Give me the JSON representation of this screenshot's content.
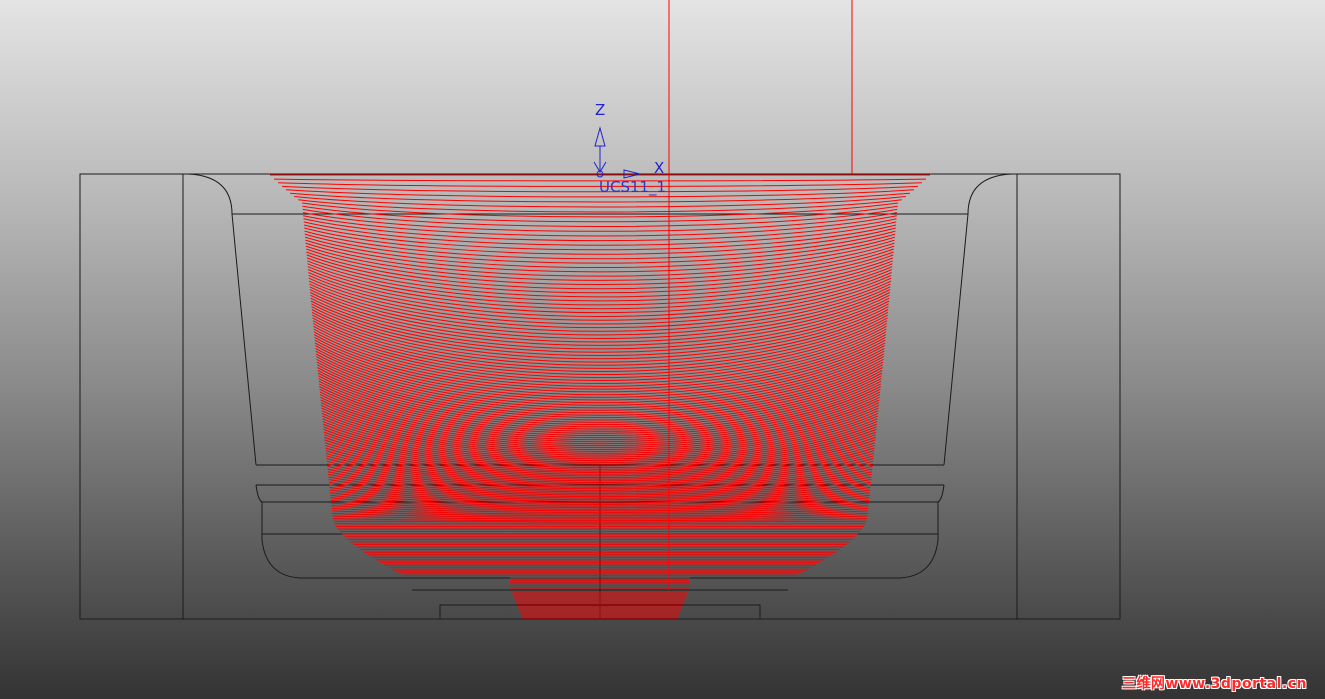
{
  "viewport": {
    "background_top": "#e4e4e4",
    "background_bottom": "#333333",
    "geometry_color": "#1a1a1a",
    "toolpath_color": "#ff0000",
    "csys_color": "#2222cc"
  },
  "csys": {
    "z_label": "Z",
    "x_label": "X",
    "name": "UCS11_1"
  },
  "watermark": {
    "text": "三维网www.3dportal.cn"
  }
}
